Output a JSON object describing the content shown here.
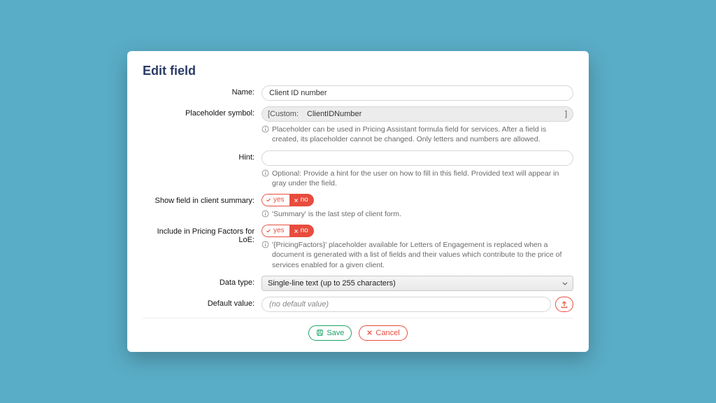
{
  "title": "Edit field",
  "labels": {
    "name": "Name:",
    "placeholder": "Placeholder symbol:",
    "hint": "Hint:",
    "show_summary": "Show field in client summary:",
    "include_loe": "Include in Pricing Factors for LoE:",
    "data_type": "Data type:",
    "default_value": "Default value:"
  },
  "fields": {
    "name": "Client ID number",
    "placeholder_prefix": "[Custom:",
    "placeholder_value": "ClientIDNumber",
    "placeholder_suffix": "]",
    "hint_value": "",
    "data_type": "Single-line text (up to 255 characters)",
    "default_placeholder": "(no default value)"
  },
  "hints": {
    "placeholder": "Placeholder can be used in Pricing Assistant formula field for services. After a field is created, its placeholder cannot be changed. Only letters and numbers are allowed.",
    "hint": "Optional: Provide a hint for the user on how to fill in this field. Provided text will appear in gray under the field.",
    "summary": "'Summary' is the last step of client form.",
    "loe": "'{PricingFactors}' placeholder available for Letters of Engagement is replaced when a document is generated with a list of fields and their values which contribute to the price of services enabled for a given client."
  },
  "toggle": {
    "yes": "yes",
    "no": "no"
  },
  "actions": {
    "save": "Save",
    "cancel": "Cancel"
  }
}
